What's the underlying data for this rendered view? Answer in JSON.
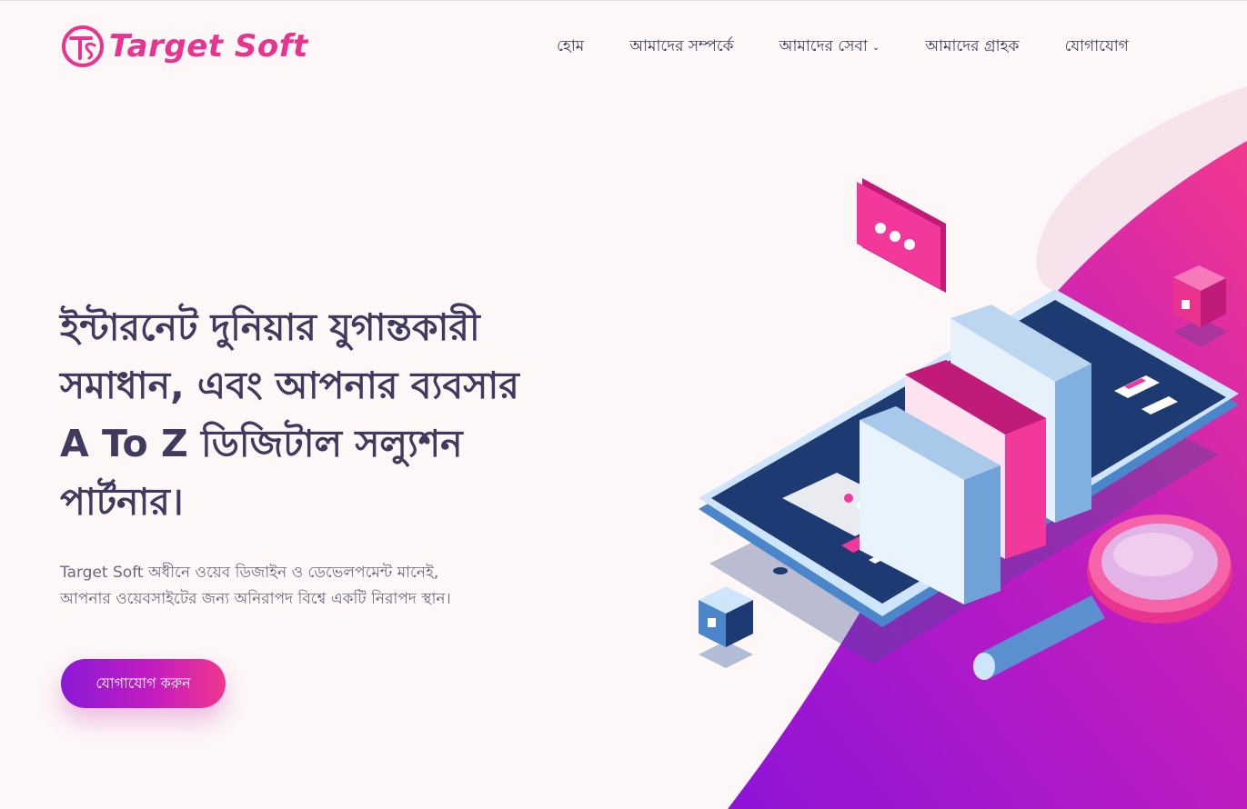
{
  "brand": {
    "name": "Target Soft",
    "monogram": "TS"
  },
  "nav": {
    "items": [
      {
        "label": "হোম",
        "has_dropdown": false
      },
      {
        "label": "আমাদের সম্পর্কে",
        "has_dropdown": false
      },
      {
        "label": "আমাদের সেবা",
        "has_dropdown": true
      },
      {
        "label": "আমাদের গ্রাহক",
        "has_dropdown": false
      },
      {
        "label": "যোগাযোগ",
        "has_dropdown": false
      }
    ]
  },
  "hero": {
    "title_lines": [
      "ইন্টারনেট দুনিয়ার যুগান্তকারী",
      "সমাধান, এবং আপনার ব্যবসার",
      "A To Z ডিজিটাল সল্যুশন",
      "পার্টনার।"
    ],
    "subtitle_lines": [
      "Target Soft অধীনে ওয়েব ডিজাইন ও ডেভেলপমেন্ট মানেই,",
      "আপনার ওয়েবসাইটের জন্য অনিরাপদ বিশ্বে একটি নিরাপদ স্থান।"
    ],
    "cta_label": "যোগাযোগ করুন"
  },
  "colors": {
    "accent_pink": "#e8338f",
    "accent_purple": "#8a1ad6",
    "heading": "#3f3a5e",
    "background": "#fdf7f8"
  },
  "icons": [
    "logo-mark-icon",
    "chevron-down-icon",
    "chat-bubble-icon",
    "magnifier-icon",
    "cube-icon"
  ]
}
